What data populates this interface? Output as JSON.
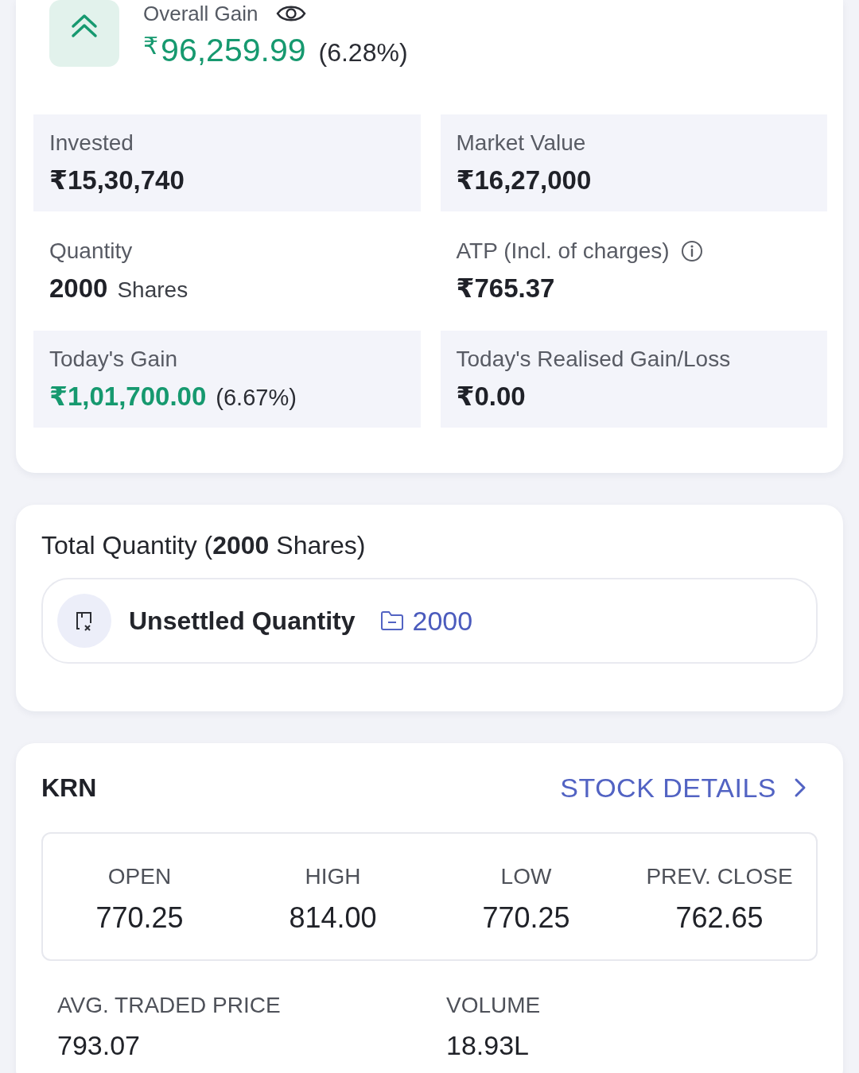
{
  "overall_gain": {
    "label": "Overall Gain",
    "amount": "$^{₹}$96,259.99",
    "percent": "(6.28%)",
    "positive": true
  },
  "summary": [
    {
      "kind": "amount",
      "label": "Invested",
      "value": "₹15,30,740",
      "info": false
    },
    {
      "kind": "amount",
      "label": "Market Value",
      "value": "₹16,27,000",
      "info": false
    },
    {
      "kind": "quantity",
      "label": "Quantity",
      "value": "2000",
      "unit": "Shares",
      "info": false
    },
    {
      "kind": "amount",
      "label": "ATP (Incl. of charges)",
      "value": "₹765.37",
      "info": true
    },
    {
      "kind": "gain",
      "label": "Today's Gain",
      "value": "₹1,01,700.00",
      "percent": "(6.67%)",
      "positive": true,
      "info": false
    },
    {
      "kind": "amount",
      "label": "Today's Realised Gain/Loss",
      "value": "₹0.00",
      "info": false
    }
  ],
  "total_quantity": {
    "title": "Total Quantity (**2000** Shares)",
    "items": [
      {
        "label": "Unsettled Quantity",
        "value": "2000"
      }
    ]
  },
  "stock": {
    "symbol": "KRN",
    "details_link": "STOCK DETAILS",
    "day_stats": [
      {
        "label": "OPEN",
        "value": "770.25"
      },
      {
        "label": "HIGH",
        "value": "814.00"
      },
      {
        "label": "LOW",
        "value": "770.25"
      },
      {
        "label": "PREV. CLOSE",
        "value": "762.65"
      }
    ],
    "more_stats": [
      {
        "label": "AVG. TRADED PRICE",
        "value": "793.07"
      },
      {
        "label": "VOLUME",
        "value": "18.93L"
      }
    ]
  }
}
